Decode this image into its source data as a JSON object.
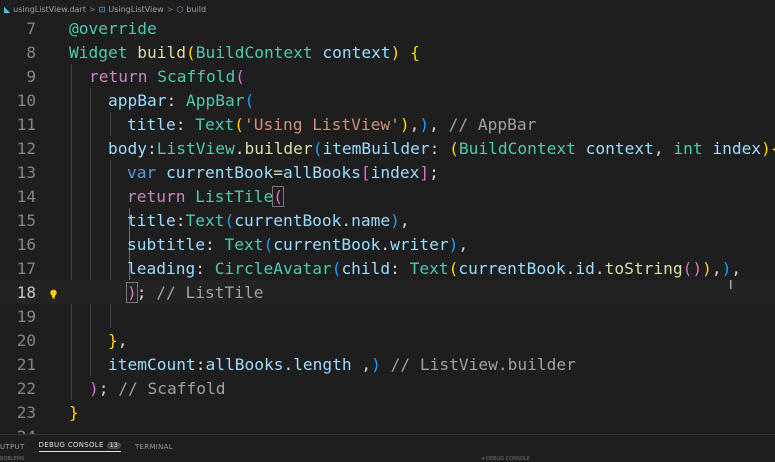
{
  "breadcrumb": {
    "file": "usingListView.dart",
    "class_name": "UsingListView",
    "method": "build",
    "separator": ">"
  },
  "icons": {
    "file": "dart-file-icon",
    "class": "class-icon",
    "method": "method-cube-icon",
    "lightbulb": "lightbulb-icon"
  },
  "editor": {
    "current_line": 18,
    "line_numbers": [
      "7",
      "8",
      "9",
      "10",
      "11",
      "12",
      "13",
      "14",
      "15",
      "16",
      "17",
      "18",
      "19",
      "20",
      "21",
      "22",
      "23",
      "24"
    ],
    "inlay": {
      "appbar": "// AppBar",
      "listtile": "// ListTile",
      "listview": "// ListView.builder",
      "scaffold": "// Scaffold"
    }
  },
  "panel": {
    "tabs": [
      {
        "label": "UTPUT"
      },
      {
        "label": "DEBUG CONSOLE",
        "badge": "13",
        "active": true
      },
      {
        "label": "TERMINAL"
      }
    ],
    "bottom_left": "ROBLEMS",
    "bottom_right": "▾ DEBUG CONSOLE"
  },
  "colors": {
    "background": "#1e1e1e",
    "keyword": "#569cd6",
    "control_keyword": "#c586c0",
    "type": "#4ec9b0",
    "function": "#dcdcaa",
    "variable": "#9cdcfe",
    "string": "#ce9178",
    "comment": "#a0a0a0",
    "bracket_gold": "#ffd700",
    "bracket_orchid": "#da70d6",
    "bracket_blue": "#179fff"
  }
}
